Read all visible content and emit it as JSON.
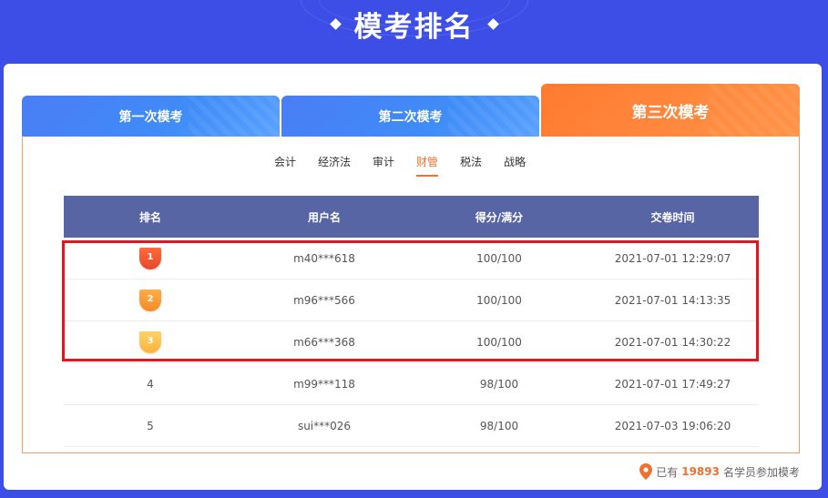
{
  "page": {
    "title": "模考排名"
  },
  "tabs": [
    {
      "label": "第一次模考"
    },
    {
      "label": "第二次模考"
    },
    {
      "label": "第三次模考",
      "active": true
    }
  ],
  "subjects": [
    {
      "label": "会计"
    },
    {
      "label": "经济法"
    },
    {
      "label": "审计"
    },
    {
      "label": "财管",
      "active": true
    },
    {
      "label": "税法"
    },
    {
      "label": "战略"
    }
  ],
  "table": {
    "headers": [
      "排名",
      "用户名",
      "得分/满分",
      "交卷时间"
    ],
    "rows": [
      {
        "rank": "1",
        "user": "m40***618",
        "score": "100/100",
        "time": "2021-07-01 12:29:07"
      },
      {
        "rank": "2",
        "user": "m96***566",
        "score": "100/100",
        "time": "2021-07-01 14:13:35"
      },
      {
        "rank": "3",
        "user": "m66***368",
        "score": "100/100",
        "time": "2021-07-01 14:30:22"
      },
      {
        "rank": "4",
        "user": "m99***118",
        "score": "98/100",
        "time": "2021-07-01 17:49:27"
      },
      {
        "rank": "5",
        "user": "sui***026",
        "score": "98/100",
        "time": "2021-07-03 19:06:20"
      }
    ]
  },
  "footer": {
    "prefix": "已有",
    "count": "19893",
    "suffix": "名学员参加模考"
  },
  "colors": {
    "background": "#3d4ee6",
    "tab_blue": "#4a7df5",
    "tab_orange": "#ff7a30",
    "header": "#5865a5",
    "accent": "#f07030",
    "highlight": "#e8141a",
    "medal_1": "#f05a2a",
    "medal_2": "#ff9a30",
    "medal_3": "#ffc24a"
  },
  "icons": {
    "footer": "location-pin-icon"
  }
}
